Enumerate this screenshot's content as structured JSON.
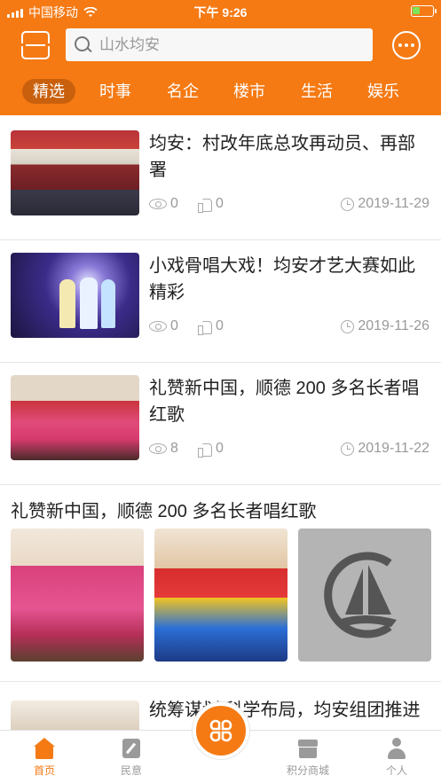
{
  "status_bar": {
    "carrier": "中国移动",
    "time": "下午 9:26"
  },
  "search": {
    "placeholder": "山水均安"
  },
  "tabs": [
    {
      "label": "精选",
      "active": true
    },
    {
      "label": "时事",
      "active": false
    },
    {
      "label": "名企",
      "active": false
    },
    {
      "label": "楼市",
      "active": false
    },
    {
      "label": "生活",
      "active": false
    },
    {
      "label": "娱乐",
      "active": false
    }
  ],
  "news": [
    {
      "title": "均安：村改年底总攻再动员、再部署",
      "views": "0",
      "likes": "0",
      "date": "2019-11-29"
    },
    {
      "title": "小戏骨唱大戏！均安才艺大赛如此精彩",
      "views": "0",
      "likes": "0",
      "date": "2019-11-26"
    },
    {
      "title": "礼赞新中国，顺德 200 多名长者唱红歌",
      "views": "8",
      "likes": "0",
      "date": "2019-11-22"
    }
  ],
  "gallery": {
    "title": "礼赞新中国，顺德 200 多名长者唱红歌"
  },
  "partial_item": {
    "title": "统筹谋划 科学布局，均安组团推进"
  },
  "bottom_nav": [
    {
      "label": "首页",
      "icon": "home-icon",
      "active": true
    },
    {
      "label": "民意",
      "icon": "pen-icon",
      "active": false
    },
    {
      "label": "积分商城",
      "icon": "shop-icon",
      "active": false
    },
    {
      "label": "个人",
      "icon": "person-icon",
      "active": false
    }
  ],
  "colors": {
    "brand": "#f57a14"
  }
}
